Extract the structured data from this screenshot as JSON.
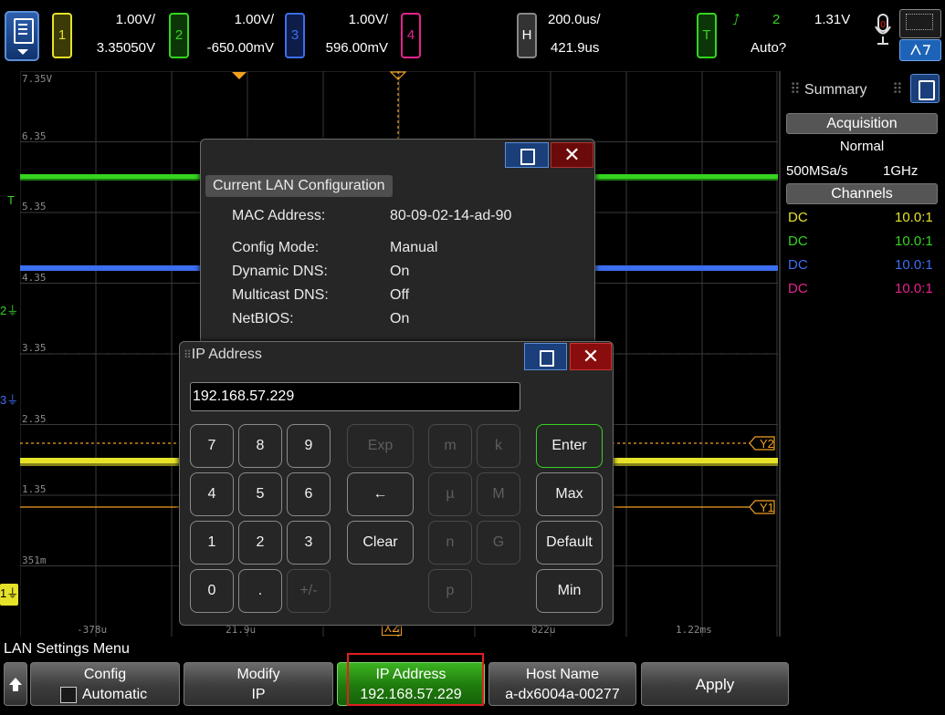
{
  "top": {
    "ch1": {
      "num": "1",
      "scale": "1.00V/",
      "offset": "3.35050V",
      "color": "#e6e229"
    },
    "ch2": {
      "num": "2",
      "scale": "1.00V/",
      "offset": "-650.00mV",
      "color": "#35d420"
    },
    "ch3": {
      "num": "3",
      "scale": "1.00V/",
      "offset": "596.00mV",
      "color": "#3c6ef0"
    },
    "ch4": {
      "num": "4",
      "color": "#e5248d"
    },
    "horiz": {
      "label": "H",
      "scale": "200.0us/",
      "delay": "421.9us"
    },
    "trigger": {
      "label": "T",
      "source": "2",
      "level": "1.31V",
      "mode": "Auto?",
      "color": "#35d420"
    }
  },
  "graticule": {
    "volt_labels": [
      "7.35V",
      "6.35",
      "5.35",
      "4.35",
      "3.35",
      "2.35",
      "1.35",
      "351m"
    ],
    "time_labels": [
      "-378u",
      "21.9u",
      "X2",
      "822u",
      "1.22ms"
    ],
    "cursor_labels": [
      "Y2",
      "Y1"
    ],
    "markers": [
      "T",
      "2",
      "3",
      "1"
    ]
  },
  "summary": {
    "tab": "Summary",
    "acq_header": "Acquisition",
    "acq_mode": "Normal",
    "sample_rate": "500MSa/s",
    "bandwidth": "1GHz",
    "ch_header": "Channels",
    "channels": [
      {
        "coupling": "DC",
        "probe": "10.0:1",
        "color": "#e6e229"
      },
      {
        "coupling": "DC",
        "probe": "10.0:1",
        "color": "#35d420"
      },
      {
        "coupling": "DC",
        "probe": "10.0:1",
        "color": "#3c6ef0"
      },
      {
        "coupling": "DC",
        "probe": "10.0:1",
        "color": "#e5248d"
      }
    ]
  },
  "lan_dialog": {
    "title": "Current LAN Configuration",
    "rows": [
      {
        "label": "MAC Address:",
        "value": "80-09-02-14-ad-90"
      },
      {
        "label": "Config Mode:",
        "value": "Manual"
      },
      {
        "label": "Dynamic DNS:",
        "value": "On"
      },
      {
        "label": "Multicast DNS:",
        "value": "Off"
      },
      {
        "label": "NetBIOS:",
        "value": "On"
      }
    ]
  },
  "ip_dialog": {
    "title": "IP Address",
    "value": "192.168.57.229",
    "keys": {
      "k7": "7",
      "k8": "8",
      "k9": "9",
      "k4": "4",
      "k5": "5",
      "k6": "6",
      "k1": "1",
      "k2": "2",
      "k3": "3",
      "k0": "0",
      "kdot": ".",
      "ksign": "+/-",
      "exp": "Exp",
      "back": "←",
      "clear": "Clear",
      "m": "m",
      "k": "k",
      "u": "µ",
      "M": "M",
      "n": "n",
      "G": "G",
      "p": "p",
      "enter": "Enter",
      "max": "Max",
      "default": "Default",
      "min": "Min"
    }
  },
  "softkeys": {
    "menu_title": "LAN Settings Menu",
    "config": {
      "label": "Config",
      "value": "Automatic"
    },
    "modify": {
      "label": "Modify",
      "value": "IP"
    },
    "ip": {
      "label": "IP Address",
      "value": "192.168.57.229"
    },
    "host": {
      "label": "Host Name",
      "value": "a-dx6004a-00277"
    },
    "apply": {
      "label": "Apply"
    }
  }
}
